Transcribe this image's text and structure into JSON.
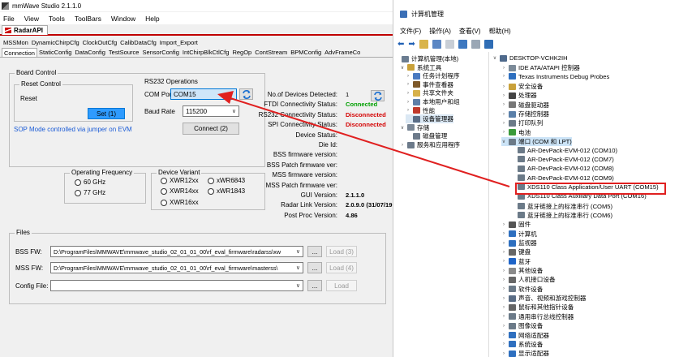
{
  "mmw": {
    "window_title": "mmWave Studio 2.1.1.0",
    "menu": [
      "File",
      "View",
      "Tools",
      "ToolBars",
      "Window",
      "Help"
    ],
    "doc_tab": "RadarAPI",
    "tabs_row1": [
      "MSSMon",
      "DynamicChirpCfg",
      "ClockOutCfg",
      "CalibDataCfg",
      "Import_Export"
    ],
    "tabs_row2": [
      "Connection",
      "StaticConfig",
      "DataConfig",
      "TestSource",
      "SensorConfig",
      "IntChirpBlkCtlCfg",
      "RegOp",
      "ContStream",
      "BPMConfig",
      "AdvFrameCo"
    ],
    "board_control": {
      "title": "Board Control",
      "reset_group": "Reset Control",
      "reset_label": "Reset",
      "set_button": "Set (1)",
      "sop_text": "SOP Mode controlled via jumper on EVM"
    },
    "rs232": {
      "title": "RS232 Operations",
      "com_port_label": "COM Port",
      "com_port_value": "COM15",
      "baud_label": "Baud Rate",
      "baud_value": "115200",
      "connect_button": "Connect (2)"
    },
    "status": {
      "rows": [
        {
          "key": "No.of Devices Detected:",
          "value": "1",
          "style": "plain"
        },
        {
          "key": "FTDI Connectivity Status:",
          "value": "Connected",
          "style": "green"
        },
        {
          "key": "RS232 Connectivity Status:",
          "value": "Disconnected",
          "style": "red"
        },
        {
          "key": "SPI Connectivity Status:",
          "value": "Disconnected",
          "style": "red"
        },
        {
          "key": "Device Status:",
          "value": "",
          "style": "plain"
        },
        {
          "key": "Die Id:",
          "value": "",
          "style": "plain"
        },
        {
          "key": "BSS firmware version:",
          "value": "",
          "style": "plain"
        },
        {
          "key": "BSS Patch firmware ver:",
          "value": "",
          "style": "plain"
        },
        {
          "key": "MSS firmware version:",
          "value": "",
          "style": "plain"
        },
        {
          "key": "MSS Patch firmware ver:",
          "value": "",
          "style": "plain"
        },
        {
          "key": "GUI Version:",
          "value": "2.1.1.0",
          "style": "bold"
        },
        {
          "key": "Radar Link Version:",
          "value": "2.0.9.0 (31/07/19",
          "style": "bold"
        },
        {
          "key": "Post Proc Version:",
          "value": "4.86",
          "style": "bold"
        }
      ]
    },
    "operating_frequency": {
      "title": "Operating Frequency",
      "options": [
        "60 GHz",
        "77 GHz"
      ]
    },
    "device_variant": {
      "title": "Device Variant",
      "options": [
        "XWR12xx",
        "xWR6843",
        "XWR14xx",
        "xWR1843",
        "XWR16xx"
      ]
    },
    "files": {
      "title": "Files",
      "rows": [
        {
          "label": "BSS FW:",
          "path": "D:\\ProgramFiles\\MMWAVE\\mmwave_studio_02_01_01_00\\rf_eval_firmware\\radarss\\xw",
          "browse": "...",
          "load": "Load (3)"
        },
        {
          "label": "MSS FW:",
          "path": "D:\\ProgramFiles\\MMWAVE\\mmwave_studio_02_01_01_00\\rf_eval_firmware\\masterss\\",
          "browse": "...",
          "load": "Load (4)"
        },
        {
          "label": "Config File:",
          "path": "",
          "browse": "...",
          "load": "Load"
        }
      ]
    }
  },
  "dm": {
    "window_title": "计算机管理",
    "menu": [
      "文件(F)",
      "操作(A)",
      "查看(V)",
      "帮助(H)"
    ],
    "left_tree": [
      {
        "label": "计算机管理(本地)",
        "indent": 0,
        "exp": "",
        "color": "#6b7d91"
      },
      {
        "label": "系统工具",
        "indent": 1,
        "exp": "∨",
        "color": "#c9a13a"
      },
      {
        "label": "任务计划程序",
        "indent": 2,
        "exp": "›",
        "color": "#4a7ac0"
      },
      {
        "label": "事件查看器",
        "indent": 2,
        "exp": "›",
        "color": "#7f5a2a"
      },
      {
        "label": "共享文件夹",
        "indent": 2,
        "exp": "›",
        "color": "#d7b14a"
      },
      {
        "label": "本地用户和组",
        "indent": 2,
        "exp": "›",
        "color": "#5e7fa8"
      },
      {
        "label": "性能",
        "indent": 2,
        "exp": "›",
        "color": "#c0392b"
      },
      {
        "label": "设备管理器",
        "indent": 2,
        "exp": "",
        "color": "#5a6d86",
        "selected": true
      },
      {
        "label": "存储",
        "indent": 1,
        "exp": "∨",
        "color": "#7a8796"
      },
      {
        "label": "磁盘管理",
        "indent": 2,
        "exp": "",
        "color": "#6c7a8a"
      },
      {
        "label": "服务和应用程序",
        "indent": 1,
        "exp": "›",
        "color": "#6c7a8a"
      }
    ],
    "right_tree": [
      {
        "label": "DESKTOP-VCHK2IH",
        "indent": 0,
        "exp": "∨",
        "color": "#4f6a8c"
      },
      {
        "label": "IDE ATA/ATAPI 控制器",
        "indent": 1,
        "exp": "›",
        "color": "#7c8b99"
      },
      {
        "label": "Texas Instruments Debug Probes",
        "indent": 1,
        "exp": "›",
        "color": "#2e6fbf"
      },
      {
        "label": "安全设备",
        "indent": 1,
        "exp": "›",
        "color": "#c9a13a"
      },
      {
        "label": "处理器",
        "indent": 1,
        "exp": "›",
        "color": "#444"
      },
      {
        "label": "磁盘驱动器",
        "indent": 1,
        "exp": "›",
        "color": "#777"
      },
      {
        "label": "存储控制器",
        "indent": 1,
        "exp": "›",
        "color": "#5a7fa8"
      },
      {
        "label": "打印队列",
        "indent": 1,
        "exp": "›",
        "color": "#6b7a88"
      },
      {
        "label": "电池",
        "indent": 1,
        "exp": "›",
        "color": "#3a9a3a"
      },
      {
        "label": "端口 (COM 和 LPT)",
        "indent": 1,
        "exp": "∨",
        "color": "#6b7a88",
        "selected": true
      },
      {
        "label": "AR-DevPack-EVM-012 (COM10)",
        "indent": 2,
        "exp": "",
        "color": "#6b7a88"
      },
      {
        "label": "AR-DevPack-EVM-012 (COM7)",
        "indent": 2,
        "exp": "",
        "color": "#6b7a88"
      },
      {
        "label": "AR-DevPack-EVM-012 (COM8)",
        "indent": 2,
        "exp": "",
        "color": "#6b7a88"
      },
      {
        "label": "AR-DevPack-EVM-012 (COM9)",
        "indent": 2,
        "exp": "",
        "color": "#6b7a88"
      },
      {
        "label": "XDS110 Class Application/User UART (COM15)",
        "indent": 2,
        "exp": "",
        "color": "#6b7a88",
        "highlight": true
      },
      {
        "label": "XDS110 Class Auxiliary Data Port (COM16)",
        "indent": 2,
        "exp": "",
        "color": "#6b7a88"
      },
      {
        "label": "蓝牙链接上的标准串行 (COM5)",
        "indent": 2,
        "exp": "",
        "color": "#6b7a88"
      },
      {
        "label": "蓝牙链接上的标准串行 (COM6)",
        "indent": 2,
        "exp": "",
        "color": "#6b7a88"
      },
      {
        "label": "固件",
        "indent": 1,
        "exp": "›",
        "color": "#555"
      },
      {
        "label": "计算机",
        "indent": 1,
        "exp": "›",
        "color": "#2e6fbf"
      },
      {
        "label": "监视器",
        "indent": 1,
        "exp": "›",
        "color": "#2e6fbf"
      },
      {
        "label": "键盘",
        "indent": 1,
        "exp": "›",
        "color": "#666"
      },
      {
        "label": "蓝牙",
        "indent": 1,
        "exp": "›",
        "color": "#1e64c8"
      },
      {
        "label": "其他设备",
        "indent": 1,
        "exp": "›",
        "color": "#8a8a8a"
      },
      {
        "label": "人机接口设备",
        "indent": 1,
        "exp": "›",
        "color": "#666"
      },
      {
        "label": "软件设备",
        "indent": 1,
        "exp": "›",
        "color": "#6b7a88"
      },
      {
        "label": "声音、视频和游戏控制器",
        "indent": 1,
        "exp": "›",
        "color": "#5a6d86"
      },
      {
        "label": "鼠标和其他指针设备",
        "indent": 1,
        "exp": "›",
        "color": "#666"
      },
      {
        "label": "通用串行总线控制器",
        "indent": 1,
        "exp": "›",
        "color": "#6b7a88"
      },
      {
        "label": "图像设备",
        "indent": 1,
        "exp": "›",
        "color": "#6b7a88"
      },
      {
        "label": "网络适配器",
        "indent": 1,
        "exp": "›",
        "color": "#2e6fbf"
      },
      {
        "label": "系统设备",
        "indent": 1,
        "exp": "›",
        "color": "#2e6fbf"
      },
      {
        "label": "显示适配器",
        "indent": 1,
        "exp": "›",
        "color": "#2e6fbf"
      }
    ]
  },
  "colors": {
    "accent_red": "#c00000",
    "highlight_box": "#e02020",
    "connected": "#00a000",
    "disconnected": "#d40000",
    "set_button": "#2e9bff"
  }
}
